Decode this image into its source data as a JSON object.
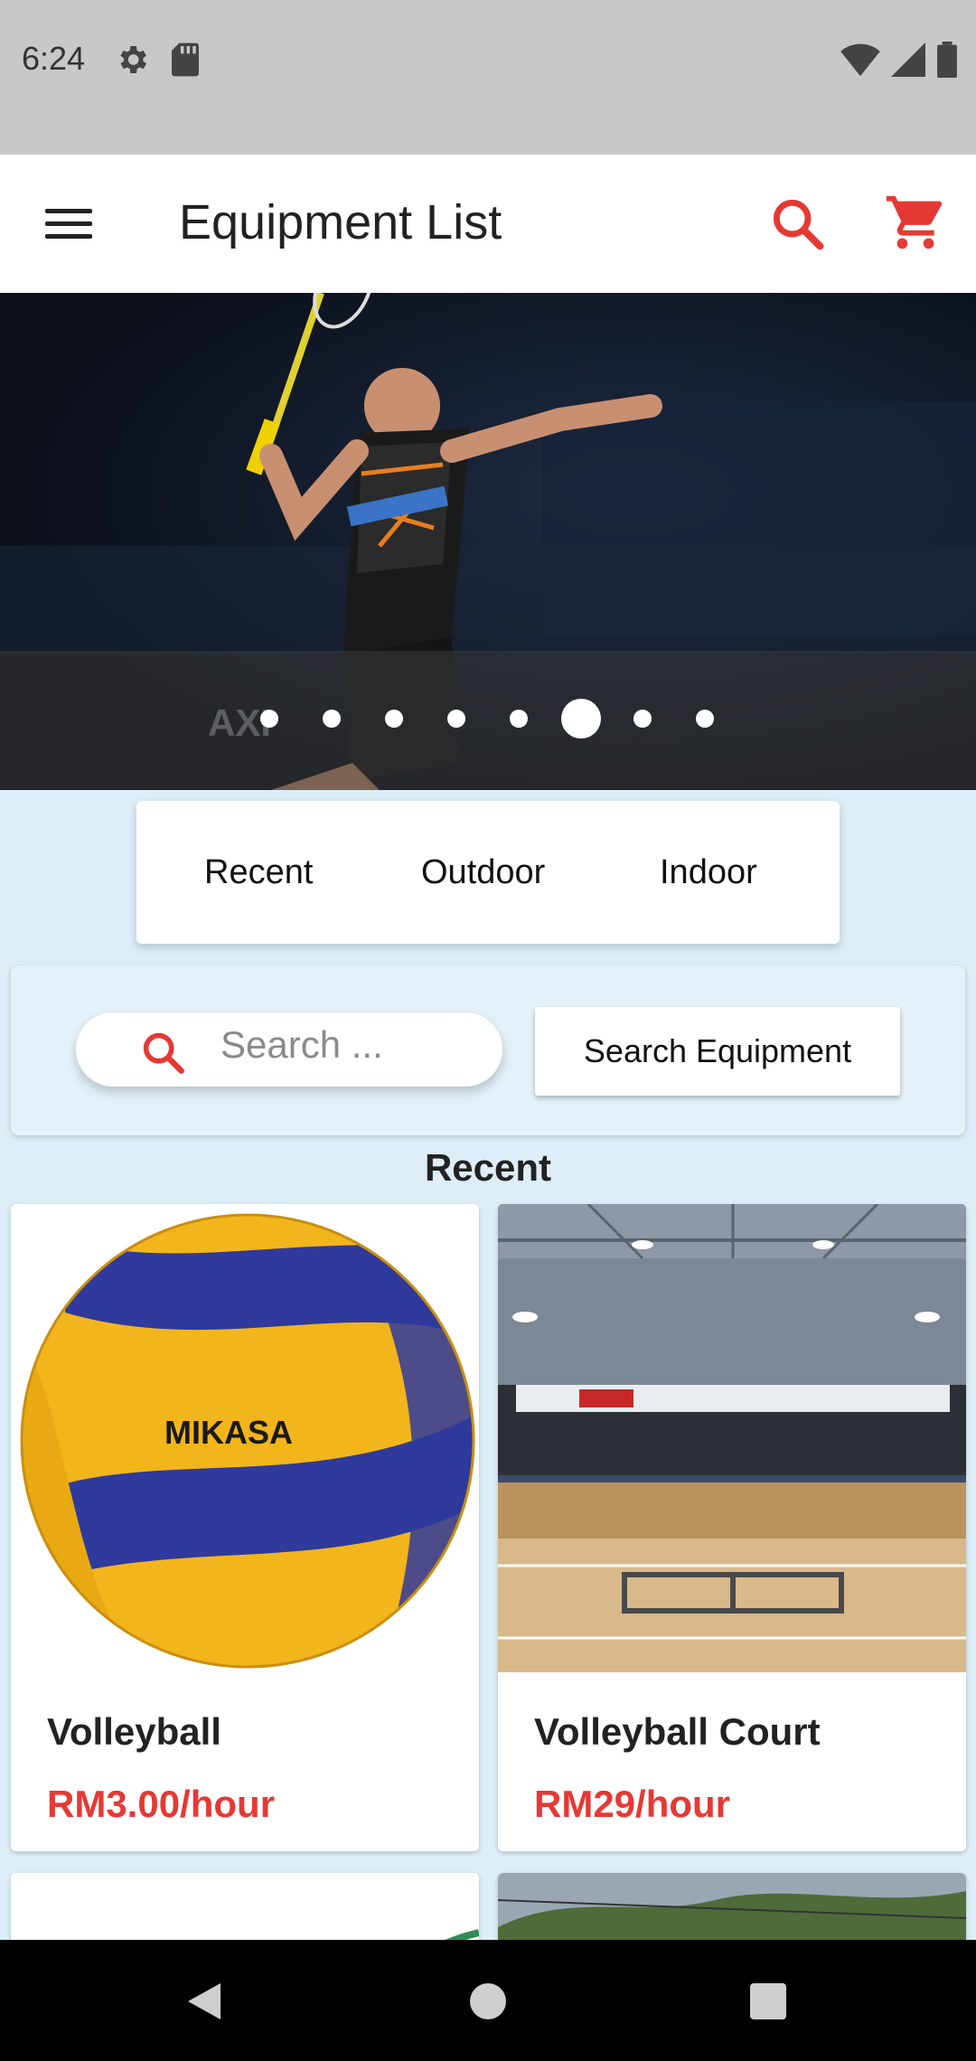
{
  "status_bar": {
    "time": "6:24"
  },
  "app_bar": {
    "title": "Equipment List"
  },
  "carousel": {
    "dot_count": 8,
    "active_index": 5
  },
  "categories": [
    {
      "label": "Recent"
    },
    {
      "label": "Outdoor"
    },
    {
      "label": "Indoor"
    }
  ],
  "search": {
    "placeholder": "Search ...",
    "button_label": "Search Equipment"
  },
  "section": {
    "title": "Recent"
  },
  "products": [
    {
      "name": "Volleyball",
      "price": "RM3.00/hour"
    },
    {
      "name": "Volleyball Court",
      "price": "RM29/hour"
    }
  ],
  "colors": {
    "accent": "#e53935",
    "background": "#ddeef8",
    "status_bar": "#c8c8c8"
  }
}
